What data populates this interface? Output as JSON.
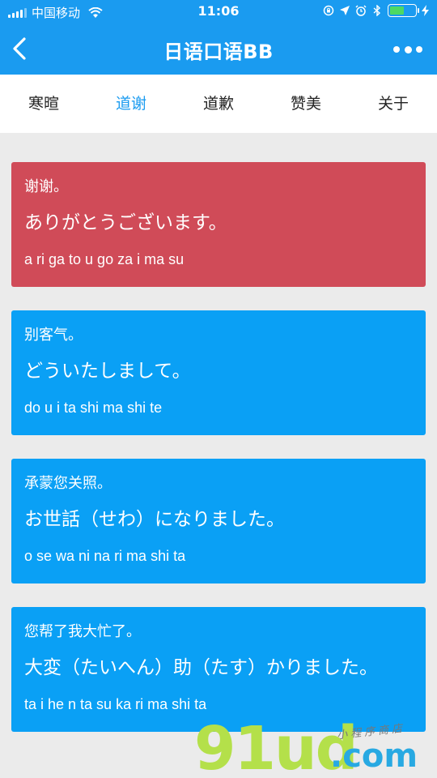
{
  "status_bar": {
    "carrier": "中国移动",
    "time": "11:06"
  },
  "nav": {
    "title": "日语口语BB"
  },
  "tabs": [
    {
      "label": "寒暄"
    },
    {
      "label": "道谢"
    },
    {
      "label": "道歉"
    },
    {
      "label": "赞美"
    },
    {
      "label": "关于"
    }
  ],
  "active_tab": "道谢",
  "colors": {
    "header_blue": "#1a9bf0",
    "card_red": "#d04b58",
    "card_blue": "#0aa0f5"
  },
  "cards": [
    {
      "zh": "谢谢。",
      "jp": "ありがとうございます。",
      "romaji": "a ri ga to u go za i ma su",
      "color": "red"
    },
    {
      "zh": "别客气。",
      "jp": "どういたしまして。",
      "romaji": "do u i ta shi ma shi te",
      "color": "blue"
    },
    {
      "zh": "承蒙您关照。",
      "jp": "お世話（せわ）になりました。",
      "romaji": "o se wa ni na ri ma shi ta",
      "color": "blue"
    },
    {
      "zh": "您帮了我大忙了。",
      "jp": "大変（たいへん）助（たす）かりました。",
      "romaji": "ta i he n ta su ka ri ma shi ta",
      "color": "blue"
    }
  ],
  "watermark": {
    "brand": "91ud",
    "domain": ".com",
    "tagline": "小程序商店"
  }
}
